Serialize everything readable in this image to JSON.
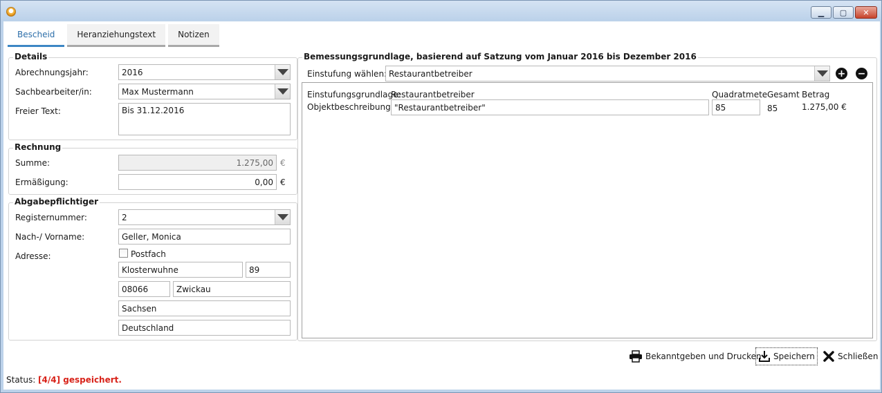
{
  "window": {
    "icon": "app-icon",
    "controls": {
      "minimize": "minimize-icon",
      "maximize": "maximize-icon",
      "close": "close-icon"
    }
  },
  "tabs": [
    {
      "label": "Bescheid",
      "active": true
    },
    {
      "label": "Heranziehungstext",
      "active": false
    },
    {
      "label": "Notizen",
      "active": false
    }
  ],
  "details": {
    "title": "Details",
    "abrechnungsjahr_label": "Abrechnungsjahr:",
    "abrechnungsjahr_value": "2016",
    "sachbearbeiter_label": "Sachbearbeiter/in:",
    "sachbearbeiter_value": "Max Mustermann",
    "freitext_label": "Freier Text:",
    "freitext_value": "Bis 31.12.2016"
  },
  "rechnung": {
    "title": "Rechnung",
    "summe_label": "Summe:",
    "summe_value": "1.275,00",
    "ermaessigung_label": "Ermäßigung:",
    "ermaessigung_value": "0,00",
    "currency": "€"
  },
  "abgabepflichtiger": {
    "title": "Abgabepflichtiger",
    "registernummer_label": "Registernummer:",
    "registernummer_value": "2",
    "name_label": "Nach-/ Vorname:",
    "name_value": "Geller, Monica",
    "adresse_label": "Adresse:",
    "postfach_label": "Postfach",
    "postfach_checked": false,
    "strasse": "Klosterwuhne",
    "hausnummer": "89",
    "plz": "08066",
    "ort": "Zwickau",
    "bundesland": "Sachsen",
    "land": "Deutschland"
  },
  "bemessung": {
    "title": "Bemessungsgrundlage, basierend auf Satzung vom Januar 2016 bis Dezember 2016",
    "einstufung_label": "Einstufung wählen:",
    "einstufung_value": "Restaurantbetreiber",
    "add_icon": "plus-circle-icon",
    "remove_icon": "minus-circle-icon",
    "grundlage_label": "Einstufungsgrundlage:",
    "grundlage_value": "Restaurantbetreiber",
    "objekt_label": "Objektbeschreibung:",
    "objekt_value": "\"Restaurantbetreiber\"",
    "qm_header": "Quadratmete",
    "qm_value": "85",
    "gesamt_header": "Gesamt",
    "gesamt_value": "85",
    "betrag_header": "Betrag",
    "betrag_value": "1.275,00 €"
  },
  "actions": {
    "print_label": "Bekanntgeben und Drucken",
    "print_icon": "printer-icon",
    "save_label": "Speichern",
    "save_icon": "download-icon",
    "close_label": "Schließen",
    "close_icon": "x-icon"
  },
  "status": {
    "label": "Status:",
    "text": "[4/4] gespeichert.",
    "color": "#d8231a"
  }
}
